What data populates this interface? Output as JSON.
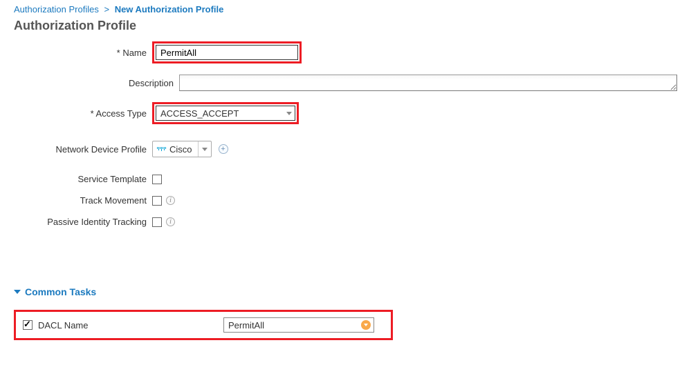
{
  "breadcrumb": {
    "parent": "Authorization Profiles",
    "current": "New Authorization Profile"
  },
  "page_title": "Authorization Profile",
  "form": {
    "name_label": "Name",
    "name_value": "PermitAll",
    "description_label": "Description",
    "description_value": "",
    "access_type_label": "Access Type",
    "access_type_value": "ACCESS_ACCEPT",
    "ndp_label": "Network Device Profile",
    "ndp_value": "Cisco",
    "service_template_label": "Service Template",
    "service_template_checked": false,
    "track_movement_label": "Track Movement",
    "track_movement_checked": false,
    "passive_identity_label": "Passive Identity Tracking",
    "passive_identity_checked": false
  },
  "common_tasks": {
    "section_title": "Common Tasks",
    "dacl": {
      "label": "DACL Name",
      "checked": true,
      "value": "PermitAll"
    }
  }
}
